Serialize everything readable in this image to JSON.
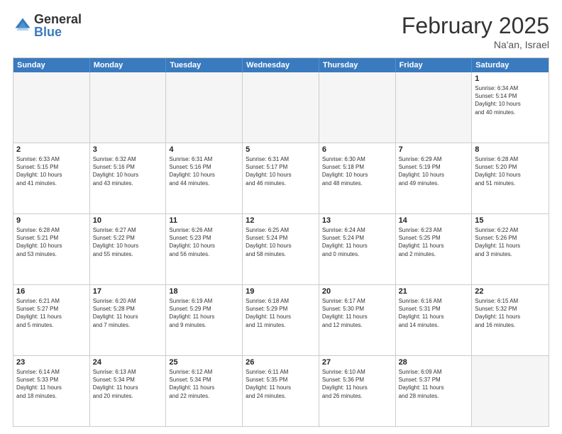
{
  "header": {
    "logo_general": "General",
    "logo_blue": "Blue",
    "month_title": "February 2025",
    "location": "Na'an, Israel"
  },
  "calendar": {
    "days_of_week": [
      "Sunday",
      "Monday",
      "Tuesday",
      "Wednesday",
      "Thursday",
      "Friday",
      "Saturday"
    ],
    "weeks": [
      [
        {
          "day": "",
          "empty": true
        },
        {
          "day": "",
          "empty": true
        },
        {
          "day": "",
          "empty": true
        },
        {
          "day": "",
          "empty": true
        },
        {
          "day": "",
          "empty": true
        },
        {
          "day": "",
          "empty": true
        },
        {
          "day": "1",
          "info": "Sunrise: 6:34 AM\nSunset: 5:14 PM\nDaylight: 10 hours\nand 40 minutes."
        }
      ],
      [
        {
          "day": "2",
          "info": "Sunrise: 6:33 AM\nSunset: 5:15 PM\nDaylight: 10 hours\nand 41 minutes."
        },
        {
          "day": "3",
          "info": "Sunrise: 6:32 AM\nSunset: 5:16 PM\nDaylight: 10 hours\nand 43 minutes."
        },
        {
          "day": "4",
          "info": "Sunrise: 6:31 AM\nSunset: 5:16 PM\nDaylight: 10 hours\nand 44 minutes."
        },
        {
          "day": "5",
          "info": "Sunrise: 6:31 AM\nSunset: 5:17 PM\nDaylight: 10 hours\nand 46 minutes."
        },
        {
          "day": "6",
          "info": "Sunrise: 6:30 AM\nSunset: 5:18 PM\nDaylight: 10 hours\nand 48 minutes."
        },
        {
          "day": "7",
          "info": "Sunrise: 6:29 AM\nSunset: 5:19 PM\nDaylight: 10 hours\nand 49 minutes."
        },
        {
          "day": "8",
          "info": "Sunrise: 6:28 AM\nSunset: 5:20 PM\nDaylight: 10 hours\nand 51 minutes."
        }
      ],
      [
        {
          "day": "9",
          "info": "Sunrise: 6:28 AM\nSunset: 5:21 PM\nDaylight: 10 hours\nand 53 minutes."
        },
        {
          "day": "10",
          "info": "Sunrise: 6:27 AM\nSunset: 5:22 PM\nDaylight: 10 hours\nand 55 minutes."
        },
        {
          "day": "11",
          "info": "Sunrise: 6:26 AM\nSunset: 5:23 PM\nDaylight: 10 hours\nand 56 minutes."
        },
        {
          "day": "12",
          "info": "Sunrise: 6:25 AM\nSunset: 5:24 PM\nDaylight: 10 hours\nand 58 minutes."
        },
        {
          "day": "13",
          "info": "Sunrise: 6:24 AM\nSunset: 5:24 PM\nDaylight: 11 hours\nand 0 minutes."
        },
        {
          "day": "14",
          "info": "Sunrise: 6:23 AM\nSunset: 5:25 PM\nDaylight: 11 hours\nand 2 minutes."
        },
        {
          "day": "15",
          "info": "Sunrise: 6:22 AM\nSunset: 5:26 PM\nDaylight: 11 hours\nand 3 minutes."
        }
      ],
      [
        {
          "day": "16",
          "info": "Sunrise: 6:21 AM\nSunset: 5:27 PM\nDaylight: 11 hours\nand 5 minutes."
        },
        {
          "day": "17",
          "info": "Sunrise: 6:20 AM\nSunset: 5:28 PM\nDaylight: 11 hours\nand 7 minutes."
        },
        {
          "day": "18",
          "info": "Sunrise: 6:19 AM\nSunset: 5:29 PM\nDaylight: 11 hours\nand 9 minutes."
        },
        {
          "day": "19",
          "info": "Sunrise: 6:18 AM\nSunset: 5:29 PM\nDaylight: 11 hours\nand 11 minutes."
        },
        {
          "day": "20",
          "info": "Sunrise: 6:17 AM\nSunset: 5:30 PM\nDaylight: 11 hours\nand 12 minutes."
        },
        {
          "day": "21",
          "info": "Sunrise: 6:16 AM\nSunset: 5:31 PM\nDaylight: 11 hours\nand 14 minutes."
        },
        {
          "day": "22",
          "info": "Sunrise: 6:15 AM\nSunset: 5:32 PM\nDaylight: 11 hours\nand 16 minutes."
        }
      ],
      [
        {
          "day": "23",
          "info": "Sunrise: 6:14 AM\nSunset: 5:33 PM\nDaylight: 11 hours\nand 18 minutes."
        },
        {
          "day": "24",
          "info": "Sunrise: 6:13 AM\nSunset: 5:34 PM\nDaylight: 11 hours\nand 20 minutes."
        },
        {
          "day": "25",
          "info": "Sunrise: 6:12 AM\nSunset: 5:34 PM\nDaylight: 11 hours\nand 22 minutes."
        },
        {
          "day": "26",
          "info": "Sunrise: 6:11 AM\nSunset: 5:35 PM\nDaylight: 11 hours\nand 24 minutes."
        },
        {
          "day": "27",
          "info": "Sunrise: 6:10 AM\nSunset: 5:36 PM\nDaylight: 11 hours\nand 26 minutes."
        },
        {
          "day": "28",
          "info": "Sunrise: 6:09 AM\nSunset: 5:37 PM\nDaylight: 11 hours\nand 28 minutes."
        },
        {
          "day": "",
          "empty": true
        }
      ]
    ]
  }
}
